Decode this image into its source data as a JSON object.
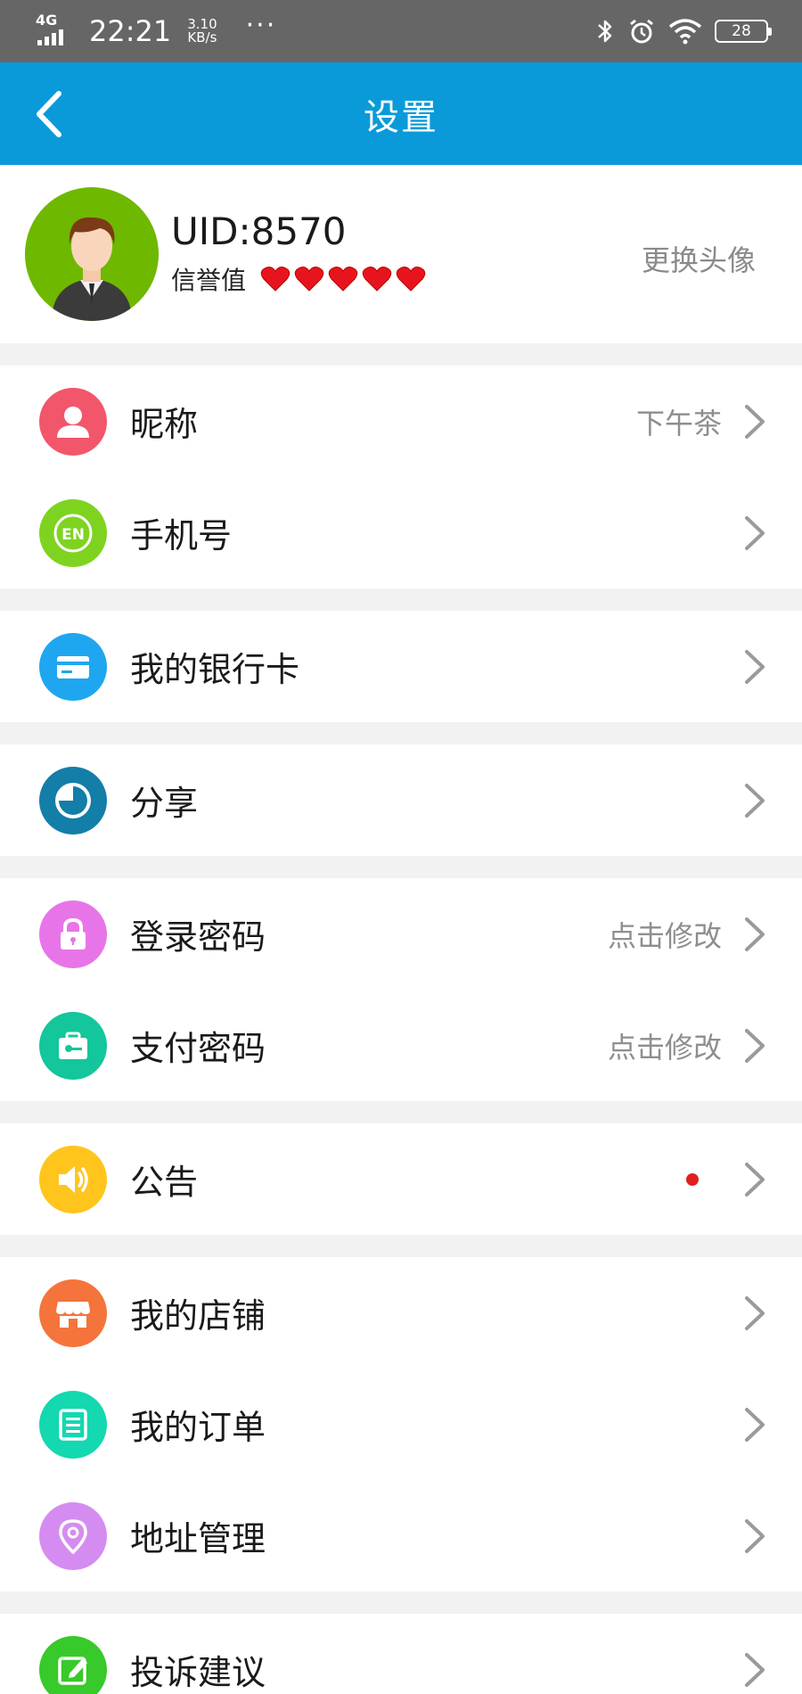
{
  "status_bar": {
    "network": "4G",
    "time": "22:21",
    "speed_value": "3.10",
    "speed_unit": "KB/s",
    "more": "···",
    "battery": "28"
  },
  "nav": {
    "title": "设置"
  },
  "profile": {
    "uid": "UID:8570",
    "credit_label": "信誉值",
    "credit_hearts": 5,
    "change_avatar": "更换头像"
  },
  "groups": [
    {
      "rows": [
        {
          "label": "昵称",
          "value": "下午茶",
          "icon": "user-icon",
          "color": "#f2566b"
        },
        {
          "label": "手机号",
          "value": "",
          "icon": "phone-en-icon",
          "color": "#7ed321"
        }
      ]
    },
    {
      "rows": [
        {
          "label": "我的银行卡",
          "value": "",
          "icon": "bank-card-icon",
          "color": "#1ea7f0"
        }
      ]
    },
    {
      "rows": [
        {
          "label": "分享",
          "value": "",
          "icon": "pie-chart-icon",
          "color": "#137ea8"
        }
      ]
    },
    {
      "rows": [
        {
          "label": "登录密码",
          "value": "点击修改",
          "icon": "lock-icon",
          "color": "#e775e8"
        },
        {
          "label": "支付密码",
          "value": "点击修改",
          "icon": "key-icon",
          "color": "#14c69b"
        }
      ]
    },
    {
      "rows": [
        {
          "label": "公告",
          "value": "",
          "icon": "speaker-icon",
          "color": "#ffc51d",
          "badge": true
        }
      ]
    },
    {
      "rows": [
        {
          "label": "我的店铺",
          "value": "",
          "icon": "store-icon",
          "color": "#f5743b"
        },
        {
          "label": "我的订单",
          "value": "",
          "icon": "order-icon",
          "color": "#13d8b0"
        },
        {
          "label": "地址管理",
          "value": "",
          "icon": "location-pin-icon",
          "color": "#d58cf0"
        }
      ]
    },
    {
      "rows": [
        {
          "label": "投诉建议",
          "value": "",
          "icon": "edit-icon",
          "color": "#38c92a"
        }
      ]
    }
  ]
}
